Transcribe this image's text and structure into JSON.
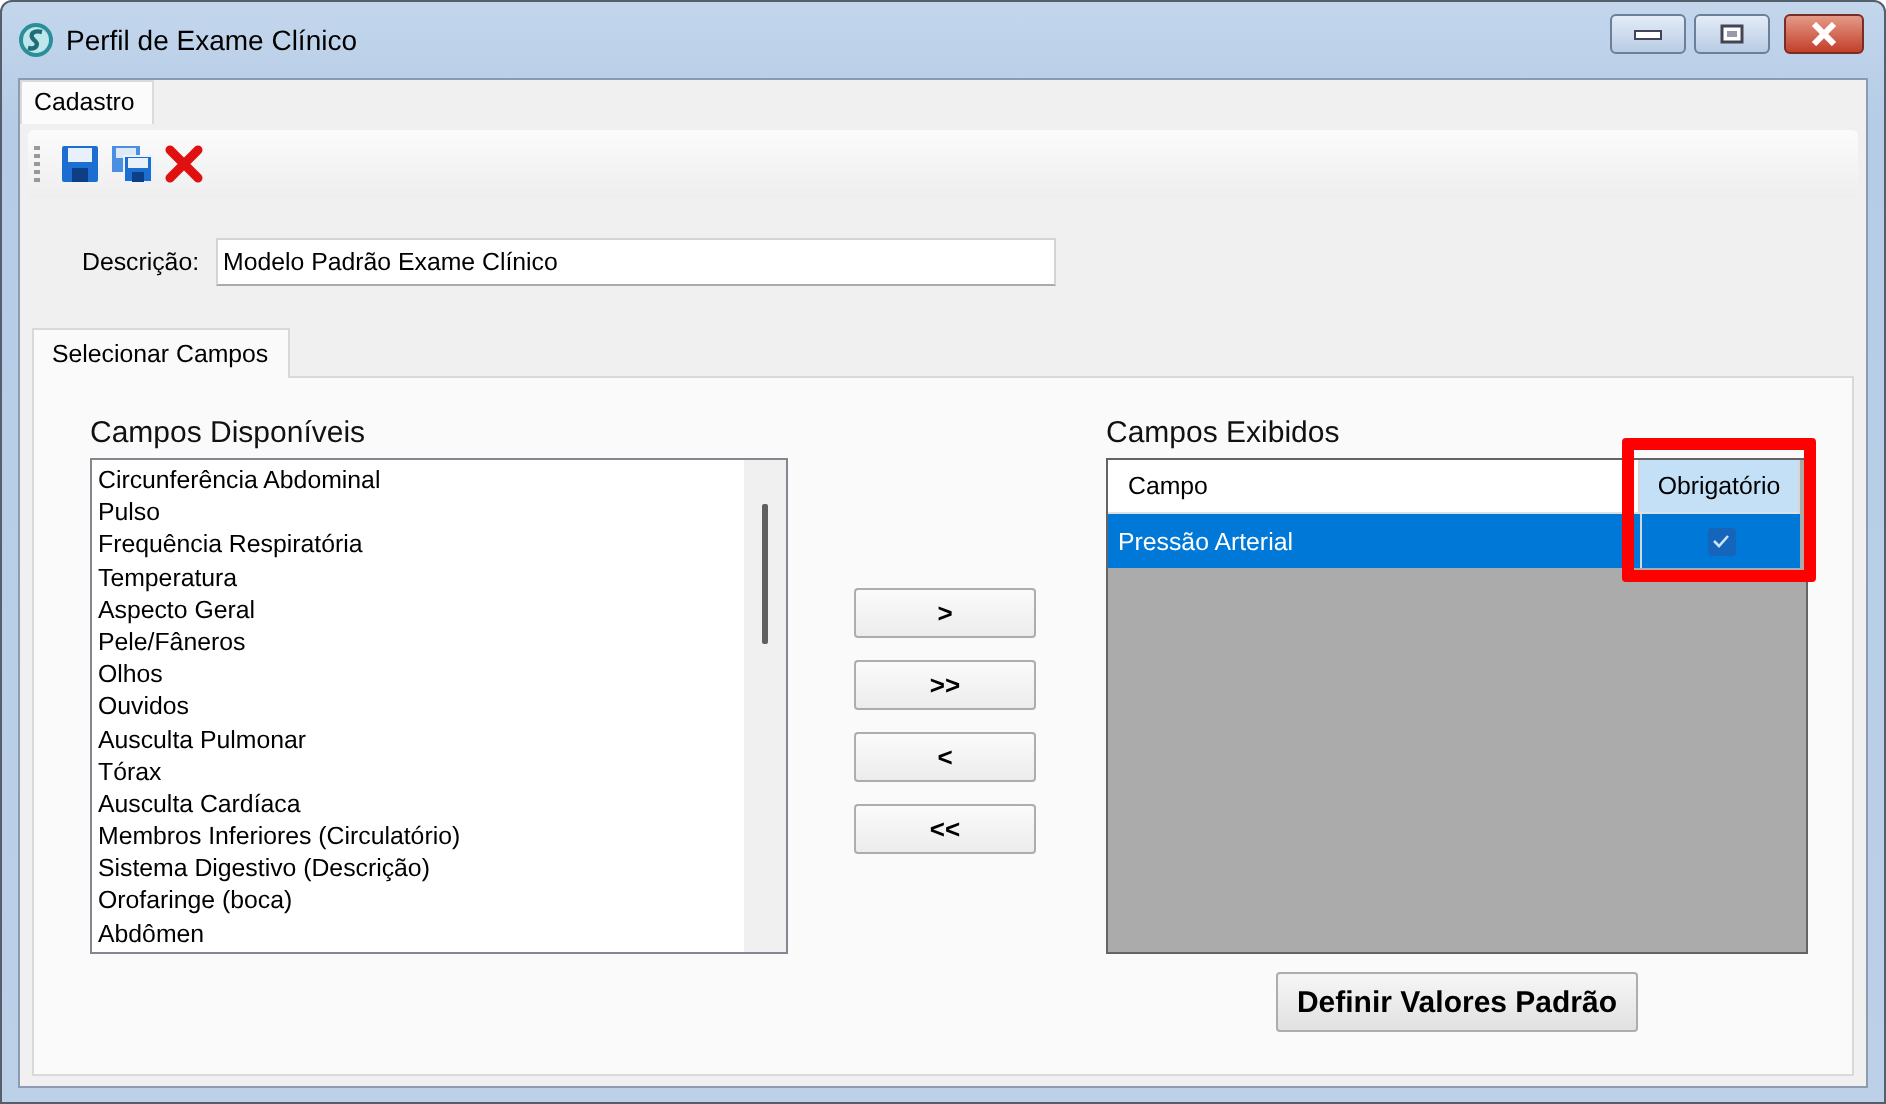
{
  "window": {
    "title": "Perfil de Exame Clínico"
  },
  "menu_tabs": [
    {
      "label": "Cadastro",
      "selected": true
    }
  ],
  "description": {
    "label": "Descrição:",
    "value": "Modelo Padrão Exame Clínico"
  },
  "tabs": [
    {
      "label": "Selecionar Campos",
      "selected": true
    }
  ],
  "available": {
    "title": "Campos Disponíveis",
    "items": [
      "Circunferência Abdominal",
      "Pulso",
      "Frequência Respiratória",
      "Temperatura",
      "Aspecto Geral",
      "Pele/Fâneros",
      "Olhos",
      "Ouvidos",
      "Ausculta Pulmonar",
      "Tórax",
      "Ausculta Cardíaca",
      "Membros Inferiores (Circulatório)",
      "Sistema Digestivo (Descrição)",
      "Orofaringe (boca)",
      "Abdômen"
    ]
  },
  "transfer_buttons": [
    ">",
    ">>",
    "<",
    "<<"
  ],
  "displayed": {
    "title": "Campos Exibidos",
    "columns": [
      "Campo",
      "Obrigatório"
    ],
    "rows": [
      {
        "field": "Pressão Arterial",
        "required": true,
        "selected": true
      }
    ]
  },
  "default_button": "Definir Valores Padrão"
}
